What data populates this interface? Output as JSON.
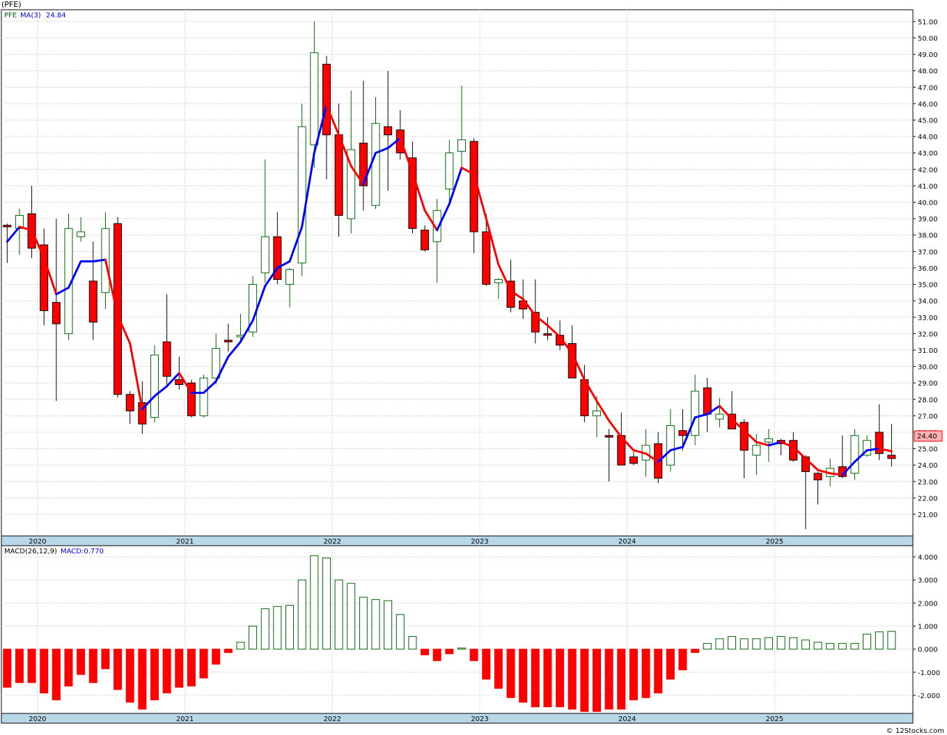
{
  "header": {
    "symbol_title": "(PFE)",
    "legend_symbol": "PFE",
    "legend_ma": "MA(3)",
    "legend_ma_value": "24.84",
    "macd_label": "MACD(26,12,9)",
    "macd_value": "MACD:0.770",
    "watermark": "© 12Stocks.com",
    "last_price": "24.40"
  },
  "colors": {
    "up": "#006400",
    "down": "#ff0000",
    "ma_up": "#0000ff",
    "ma_down": "#ff0000",
    "axis_strip": "#b8d8e8",
    "grid": "#bbbbbb"
  },
  "chart_data": [
    {
      "type": "candlestick",
      "title": "(PFE)",
      "y_range": [
        20.1,
        51.5
      ],
      "y_ticks": [
        "21.00",
        "22.00",
        "23.00",
        "24.00",
        "25.00",
        "26.00",
        "27.00",
        "28.00",
        "29.00",
        "30.00",
        "31.00",
        "32.00",
        "33.00",
        "34.00",
        "35.00",
        "36.00",
        "37.00",
        "38.00",
        "39.00",
        "40.00",
        "41.00",
        "42.00",
        "43.00",
        "44.00",
        "45.00",
        "46.00",
        "47.00",
        "48.00",
        "49.00",
        "50.00",
        "51.00"
      ],
      "x_labels": [
        "2020",
        "2021",
        "2022",
        "2023",
        "2024",
        "2025"
      ],
      "x_label_month_index": [
        1,
        13,
        25,
        37,
        49,
        61
      ],
      "months": [
        [
          "2019-12",
          38.6,
          38.7,
          36.3,
          38.5
        ],
        [
          "2020-01",
          38.4,
          39.6,
          36.8,
          39.2
        ],
        [
          "2020-02",
          39.3,
          41.0,
          36.6,
          37.2
        ],
        [
          "2020-03",
          37.4,
          38.4,
          32.5,
          33.4
        ],
        [
          "2020-04",
          33.9,
          39.0,
          27.9,
          32.6
        ],
        [
          "2020-05",
          32.0,
          39.3,
          31.6,
          38.4
        ],
        [
          "2020-06",
          37.9,
          39.1,
          37.6,
          38.2
        ],
        [
          "2020-07",
          35.2,
          37.6,
          31.6,
          32.7
        ],
        [
          "2020-08",
          34.5,
          39.4,
          33.5,
          38.4
        ],
        [
          "2020-09",
          38.7,
          39.1,
          28.1,
          28.3
        ],
        [
          "2020-10",
          28.3,
          28.5,
          26.5,
          27.3
        ],
        [
          "2020-11",
          27.8,
          29.1,
          25.9,
          26.5
        ],
        [
          "2020-12",
          26.9,
          31.3,
          26.6,
          30.7
        ],
        [
          "2021-01",
          31.5,
          34.4,
          28.9,
          29.4
        ],
        [
          "2021-02",
          29.2,
          30.6,
          28.6,
          28.9
        ],
        [
          "2021-03",
          29.0,
          29.2,
          26.9,
          27.0
        ],
        [
          "2021-04",
          27.0,
          29.5,
          26.9,
          29.3
        ],
        [
          "2021-05",
          29.3,
          32.0,
          28.9,
          31.1
        ],
        [
          "2021-06",
          31.6,
          32.6,
          30.9,
          31.5
        ],
        [
          "2021-07",
          31.8,
          33.2,
          31.6,
          31.9
        ],
        [
          "2021-08",
          32.1,
          35.5,
          31.8,
          35.0
        ],
        [
          "2021-09",
          35.7,
          42.6,
          35.1,
          37.9
        ],
        [
          "2021-10",
          37.9,
          39.4,
          35.0,
          35.3
        ],
        [
          "2021-11",
          35.0,
          36.0,
          33.6,
          35.9
        ],
        [
          "2021-12",
          36.3,
          46.0,
          35.5,
          44.6
        ],
        [
          "2022-01",
          43.5,
          51.0,
          42.1,
          49.1
        ],
        [
          "2022-02",
          48.4,
          48.9,
          41.4,
          44.1
        ],
        [
          "2022-03",
          44.1,
          46.0,
          37.9,
          39.2
        ],
        [
          "2022-04",
          39.0,
          46.8,
          38.1,
          43.2
        ],
        [
          "2022-05",
          43.6,
          47.4,
          39.5,
          41.0
        ],
        [
          "2022-06",
          39.8,
          46.4,
          39.6,
          44.8
        ],
        [
          "2022-07",
          44.6,
          48.0,
          40.7,
          44.1
        ],
        [
          "2022-08",
          44.4,
          45.6,
          42.6,
          43.0
        ],
        [
          "2022-09",
          42.7,
          43.7,
          38.1,
          38.4
        ],
        [
          "2022-10",
          38.3,
          38.6,
          37.0,
          37.1
        ],
        [
          "2022-11",
          37.6,
          40.2,
          35.1,
          39.5
        ],
        [
          "2022-12",
          40.8,
          43.8,
          39.9,
          43.0
        ],
        [
          "2023-01",
          43.1,
          47.1,
          41.9,
          43.8
        ],
        [
          "2023-02",
          43.7,
          43.9,
          36.9,
          38.2
        ],
        [
          "2023-03",
          38.2,
          39.3,
          34.9,
          35.0
        ],
        [
          "2023-04",
          35.1,
          35.4,
          34.1,
          35.3
        ],
        [
          "2023-05",
          35.2,
          36.5,
          33.3,
          33.6
        ],
        [
          "2023-06",
          34.0,
          35.3,
          32.9,
          33.5
        ],
        [
          "2023-07",
          33.3,
          35.3,
          31.4,
          32.1
        ],
        [
          "2023-08",
          32.0,
          33.0,
          31.6,
          31.9
        ],
        [
          "2023-09",
          31.9,
          32.8,
          31.0,
          31.3
        ],
        [
          "2023-10",
          31.4,
          32.5,
          29.5,
          29.3
        ],
        [
          "2023-11",
          29.2,
          30.1,
          26.6,
          27.0
        ],
        [
          "2023-12",
          27.0,
          28.2,
          25.7,
          27.3
        ],
        [
          "2024-01",
          25.8,
          26.2,
          23.0,
          25.7
        ],
        [
          "2024-02",
          25.8,
          27.2,
          24.6,
          24.0
        ],
        [
          "2024-03",
          24.5,
          24.8,
          24.0,
          24.1
        ],
        [
          "2024-04",
          24.3,
          26.2,
          23.3,
          25.2
        ],
        [
          "2024-05",
          25.3,
          26.0,
          22.9,
          23.2
        ],
        [
          "2024-06",
          24.0,
          27.4,
          23.6,
          26.4
        ],
        [
          "2024-07",
          26.1,
          27.4,
          24.9,
          25.8
        ],
        [
          "2024-08",
          25.8,
          29.5,
          25.2,
          28.5
        ],
        [
          "2024-09",
          28.7,
          29.3,
          26.0,
          27.1
        ],
        [
          "2024-10",
          26.8,
          28.1,
          26.3,
          27.1
        ],
        [
          "2024-11",
          27.1,
          28.5,
          26.2,
          26.2
        ],
        [
          "2024-12",
          26.6,
          26.8,
          23.2,
          24.9
        ],
        [
          "2025-01",
          24.6,
          25.9,
          23.4,
          25.2
        ],
        [
          "2025-02",
          25.4,
          26.2,
          24.2,
          25.6
        ],
        [
          "2025-03",
          25.5,
          25.6,
          24.6,
          25.3
        ],
        [
          "2025-04",
          25.5,
          26.0,
          24.2,
          24.3
        ],
        [
          "2025-05",
          24.5,
          24.6,
          20.1,
          23.6
        ],
        [
          "2025-06",
          23.5,
          23.6,
          21.6,
          23.1
        ],
        [
          "2025-07",
          23.3,
          24.4,
          22.7,
          23.8
        ],
        [
          "2025-08",
          23.9,
          25.8,
          23.2,
          23.3
        ],
        [
          "2025-09",
          23.5,
          26.2,
          23.1,
          25.8
        ],
        [
          "2025-10",
          24.6,
          25.8,
          24.5,
          25.5
        ],
        [
          "2025-11",
          26.0,
          27.7,
          24.3,
          24.7
        ],
        [
          "2025-12",
          24.6,
          26.5,
          23.9,
          24.4
        ]
      ],
      "ma3": [
        37.6,
        38.5,
        38.3,
        36.6,
        34.4,
        34.8,
        36.4,
        36.4,
        36.5,
        33.1,
        31.4,
        27.4,
        28.2,
        28.8,
        29.6,
        28.4,
        28.4,
        29.1,
        30.6,
        31.5,
        32.8,
        34.9,
        36.0,
        36.4,
        38.5,
        43.0,
        45.9,
        44.1,
        42.2,
        41.1,
        43.0,
        43.3,
        43.9,
        41.8,
        39.5,
        38.3,
        39.9,
        42.1,
        41.7,
        39.0,
        36.2,
        34.6,
        34.1,
        33.1,
        32.5,
        31.8,
        30.8,
        29.2,
        27.9,
        26.7,
        25.7,
        24.9,
        24.7,
        24.2,
        24.9,
        25.1,
        26.9,
        27.1,
        27.6,
        26.8,
        26.1,
        25.4,
        25.2,
        25.4,
        25.1,
        24.4,
        23.7,
        23.5,
        23.4,
        24.2,
        24.9,
        25.0,
        24.84
      ],
      "macd_panel": {
        "label": "MACD(26,12,9)",
        "y_range": [
          -2.7,
          4.3
        ],
        "y_ticks": [
          "-2.000",
          "-1.000",
          "0.000",
          "1.000",
          "2.000",
          "3.000",
          "4.000"
        ],
        "histogram": [
          -1.65,
          -1.45,
          -1.45,
          -1.9,
          -2.2,
          -1.6,
          -1.1,
          -1.45,
          -0.85,
          -1.75,
          -2.3,
          -2.6,
          -2.2,
          -1.9,
          -1.65,
          -1.6,
          -1.25,
          -0.65,
          -0.15,
          0.3,
          1.0,
          1.75,
          1.85,
          1.9,
          3.0,
          4.05,
          3.95,
          3.0,
          2.85,
          2.25,
          2.15,
          2.1,
          1.5,
          0.55,
          -0.25,
          -0.5,
          -0.2,
          0.05,
          -0.5,
          -1.3,
          -1.7,
          -2.1,
          -2.3,
          -2.5,
          -2.5,
          -2.5,
          -2.6,
          -2.7,
          -2.7,
          -2.6,
          -2.6,
          -2.2,
          -2.1,
          -1.9,
          -1.3,
          -0.9,
          -0.15,
          0.25,
          0.45,
          0.55,
          0.45,
          0.45,
          0.5,
          0.55,
          0.5,
          0.4,
          0.3,
          0.25,
          0.25,
          0.25,
          0.65,
          0.75,
          0.77
        ]
      }
    }
  ]
}
